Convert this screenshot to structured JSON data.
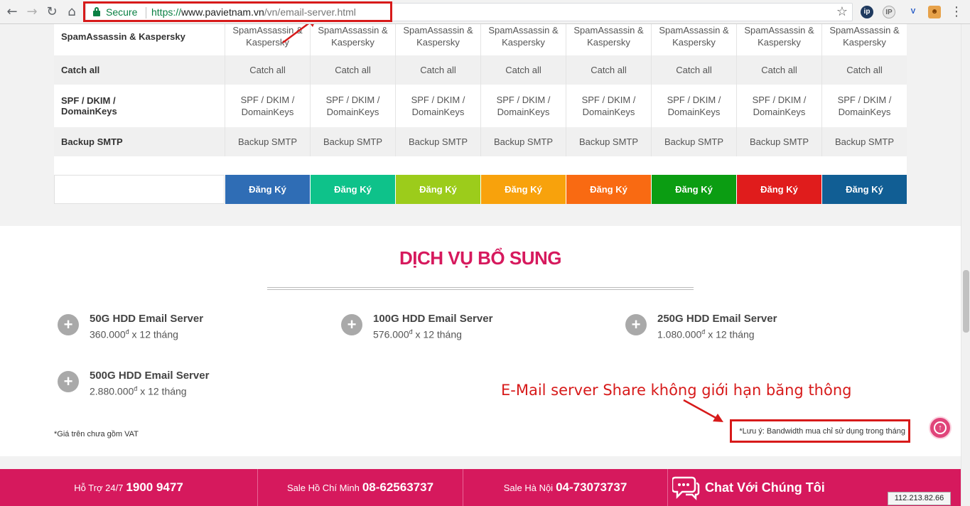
{
  "browser": {
    "secure_label": "Secure",
    "url_scheme": "https://",
    "url_host": "www.pavietnam.vn",
    "url_path": "/vn/email-server.html",
    "extensions": [
      "ip",
      "IP",
      "V",
      "ext"
    ]
  },
  "feature_rows": [
    {
      "label": "SpamAssassin & Kaspersky",
      "value": "SpamAssassin & Kaspersky"
    },
    {
      "label": "Catch all",
      "value": "Catch all"
    },
    {
      "label": "SPF / DKIM / DomainKeys",
      "value": "SPF / DKIM / DomainKeys"
    },
    {
      "label": "Backup SMTP",
      "value": "Backup SMTP"
    }
  ],
  "plans": [
    {
      "button": "Đăng Ký",
      "color": "#2f6db5"
    },
    {
      "button": "Đăng Ký",
      "color": "#0ec28a"
    },
    {
      "button": "Đăng Ký",
      "color": "#9ccc1b"
    },
    {
      "button": "Đăng Ký",
      "color": "#f8a20c"
    },
    {
      "button": "Đăng Ký",
      "color": "#f96a12"
    },
    {
      "button": "Đăng Ký",
      "color": "#0b9d12"
    },
    {
      "button": "Đăng Ký",
      "color": "#e01c1c"
    },
    {
      "button": "Đăng Ký",
      "color": "#115e94"
    }
  ],
  "additional_services": {
    "title": "DỊCH VỤ BỔ SUNG",
    "items": [
      {
        "name": "50G HDD Email Server",
        "price": "360.000",
        "currency": "đ",
        "term": " x 12 tháng"
      },
      {
        "name": "100G HDD Email Server",
        "price": "576.000",
        "currency": "đ",
        "term": " x 12 tháng"
      },
      {
        "name": "250G HDD Email Server",
        "price": "1.080.000",
        "currency": "đ",
        "term": " x 12 tháng"
      },
      {
        "name": "500G HDD Email Server",
        "price": "2.880.000",
        "currency": "đ",
        "term": " x 12 tháng"
      }
    ],
    "vat_note": "*Giá trên chưa gồm VAT",
    "bandwidth_note": "*Lưu ý: Bandwidth mua chỉ sử dụng trong tháng"
  },
  "annotation": {
    "text": "E-Mail server Share không giới hạn băng thông",
    "color": "#d71a1a"
  },
  "footer": {
    "support_label": "Hỗ Trợ 24/7",
    "support_number": "1900 9477",
    "hcm_label": "Sale Hồ Chí Minh",
    "hcm_number": "08-62563737",
    "hn_label": "Sale Hà Nội",
    "hn_number": "04-73073737",
    "chat_label": "Chat Với Chúng Tôi"
  },
  "ip_address": "112.213.82.66",
  "colors": {
    "brand": "#d6195d",
    "annotation": "#d71a1a",
    "secure": "#0b8043"
  }
}
